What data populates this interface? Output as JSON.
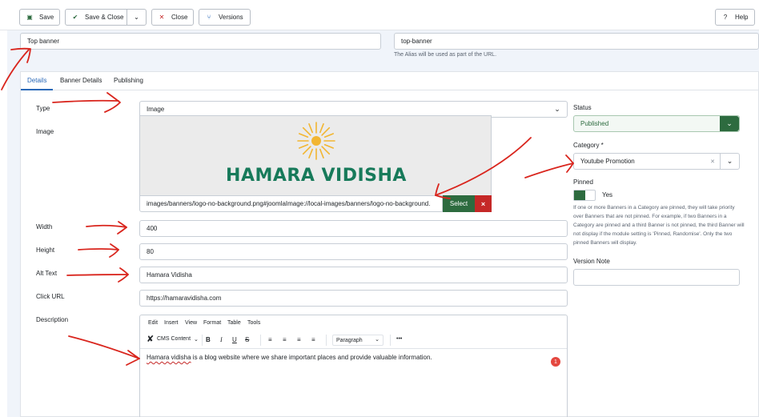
{
  "toolbar": {
    "save_label": "Save",
    "save_close_label": "Save & Close",
    "close_label": "Close",
    "versions_label": "Versions",
    "help_label": "Help"
  },
  "header": {
    "title_value": "Top banner",
    "alias_value": "top-banner",
    "alias_help": "The Alias will be used as part of the URL."
  },
  "tabs": [
    {
      "label": "Details",
      "active": true
    },
    {
      "label": "Banner Details",
      "active": false
    },
    {
      "label": "Publishing",
      "active": false
    }
  ],
  "form": {
    "type_label": "Type",
    "type_value": "Image",
    "image_label": "Image",
    "image_logo_text": "HAMARA VIDISHA",
    "image_path": "images/banners/logo-no-background.png#joomlaImage://local-images/banners/logo-no-background.",
    "select_label": "Select",
    "clear_label": "×",
    "width_label": "Width",
    "width_value": "400",
    "height_label": "Height",
    "height_value": "80",
    "alt_label": "Alt Text",
    "alt_value": "Hamara Vidisha",
    "click_label": "Click URL",
    "click_value": "https://hamaravidisha.com",
    "desc_label": "Description"
  },
  "editor": {
    "menu": [
      "Edit",
      "Insert",
      "View",
      "Format",
      "Table",
      "Tools"
    ],
    "cms_content": "CMS Content",
    "paragraph": "Paragraph",
    "more": "•••",
    "content_first": "Hamara vidisha",
    "content_rest": " is a blog website where we share important places and provide valuable information.",
    "badge": "1"
  },
  "sidebar": {
    "status_label": "Status",
    "status_value": "Published",
    "category_label": "Category *",
    "category_value": "Youtube Promotion",
    "pinned_label": "Pinned",
    "pinned_value": "Yes",
    "pinned_help": "If one or more Banners in a Category are pinned, they will take priority over Banners that are not pinned. For example, if two Banners in a Category are pinned and a third Banner is not pinned, the third Banner will not display if the module setting is 'Pinned, Randomise'. Only the two pinned Banners will display.",
    "version_note_label": "Version Note",
    "version_note_value": ""
  },
  "colors": {
    "accent": "#2a69b8",
    "success": "#2d6b3f",
    "danger": "#c52827",
    "annotation": "#d9251d"
  }
}
